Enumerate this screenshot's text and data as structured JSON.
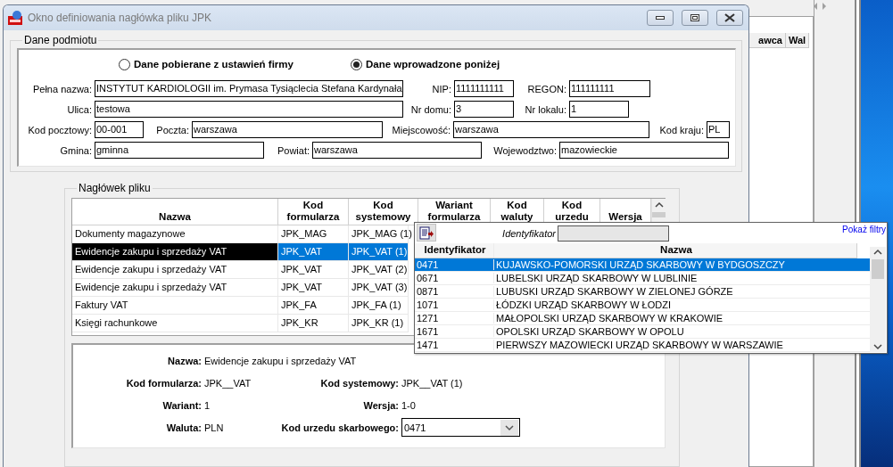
{
  "background_window": {
    "columns": [
      "awca",
      "Wal"
    ]
  },
  "window": {
    "title": "Okno definiowania nagłówka pliku JPK"
  },
  "entity_group": {
    "title": "Dane podmiotu",
    "source_options": [
      {
        "label": "Dane pobierane z ustawień firmy",
        "selected": false
      },
      {
        "label": "Dane wprowadzone poniżej",
        "selected": true
      }
    ],
    "field_rows": [
      [
        {
          "label": "Pełna nazwa:",
          "value": "INSTYTUT KARDIOLOGII im. Prymasa Tysiąclecia Stefana Kardynała"
        },
        {
          "label": "NIP:",
          "value": "1111111111"
        },
        {
          "label": "REGON:",
          "value": "111111111"
        }
      ],
      [
        {
          "label": "Ulica:",
          "value": "testowa"
        },
        {
          "label": "Nr domu:",
          "value": "3"
        },
        {
          "label": "Nr lokalu:",
          "value": "1"
        }
      ],
      [
        {
          "label": "Kod pocztowy:",
          "value": "00-001"
        },
        {
          "label": "Poczta:",
          "value": "warszawa"
        },
        {
          "label": "Miejscowość:",
          "value": "warszawa"
        },
        {
          "label": "Kod kraju:",
          "value": "PL"
        }
      ],
      [
        {
          "label": "Gmina:",
          "value": "gminna"
        },
        {
          "label": "Powiat:",
          "value": "warszawa"
        },
        {
          "label": "Wojewodztwo:",
          "value": "mazowieckie"
        }
      ]
    ]
  },
  "header_group": {
    "title": "Nagłówek pliku",
    "table": {
      "columns": [
        "Nazwa",
        "Kod formularza",
        "Kod systemowy",
        "Wariant formularza",
        "Kod waluty",
        "Kod urzedu",
        "Wersja"
      ],
      "rows": [
        {
          "cells": [
            "Dokumenty magazynowe",
            "JPK_MAG",
            "JPK_MAG (1)"
          ],
          "selected": false
        },
        {
          "cells": [
            "Ewidencje zakupu i sprzedaży VAT",
            "JPK_VAT",
            "JPK_VAT (1)"
          ],
          "selected": true
        },
        {
          "cells": [
            "Ewidencje zakupu i sprzedaży VAT",
            "JPK_VAT",
            "JPK_VAT (2)"
          ],
          "selected": false
        },
        {
          "cells": [
            "Ewidencje zakupu i sprzedaży VAT",
            "JPK_VAT",
            "JPK_VAT (3)"
          ],
          "selected": false
        },
        {
          "cells": [
            "Faktury VAT",
            "JPK_FA",
            "JPK_FA (1)"
          ],
          "selected": false
        },
        {
          "cells": [
            "Księgi rachunkowe",
            "JPK_KR",
            "JPK_KR (1)"
          ],
          "selected": false
        }
      ]
    },
    "details": [
      {
        "kind": "text",
        "label": "Nazwa:",
        "value": "Ewidencje zakupu i sprzedaży VAT"
      },
      {
        "kind": "text",
        "label": "Kod formularza:",
        "value": "JPK__VAT"
      },
      {
        "kind": "text",
        "label": "Kod systemowy:",
        "value": "JPK__VAT (1)"
      },
      {
        "kind": "text",
        "label": "Wariant:",
        "value": "1"
      },
      {
        "kind": "text",
        "label": "Wersja:",
        "value": "1-0"
      },
      {
        "kind": "text",
        "label": "Waluta:",
        "value": "PLN"
      },
      {
        "kind": "combo",
        "label": "Kod urzedu skarbowego:",
        "value": "0471"
      }
    ]
  },
  "office_popup": {
    "filter_label": "Identyfikator",
    "show_filters_link": "Pokaż filtry",
    "columns": [
      "Identyfikator",
      "Nazwa"
    ],
    "rows": [
      {
        "id": "0471",
        "name": "KUJAWSKO-POMORSKI URZĄD SKARBOWY W BYDGOSZCZY",
        "selected": true
      },
      {
        "id": "0671",
        "name": "LUBELSKI URZĄD SKARBOWY W LUBLINIE",
        "selected": false
      },
      {
        "id": "0871",
        "name": "LUBUSKI URZĄD SKARBOWY W ZIELONEJ GÓRZE",
        "selected": false
      },
      {
        "id": "1071",
        "name": "ŁÓDZKI URZĄD SKARBOWY W ŁODZI",
        "selected": false
      },
      {
        "id": "1271",
        "name": "MAŁOPOLSKI URZĄD SKARBOWY W KRAKOWIE",
        "selected": false
      },
      {
        "id": "1671",
        "name": "OPOLSKI URZĄD SKARBOWY W OPOLU",
        "selected": false
      },
      {
        "id": "1471",
        "name": "PIERWSZY MAZOWIECKI URZĄD SKARBOWY W WARSZAWIE",
        "selected": false
      }
    ]
  }
}
